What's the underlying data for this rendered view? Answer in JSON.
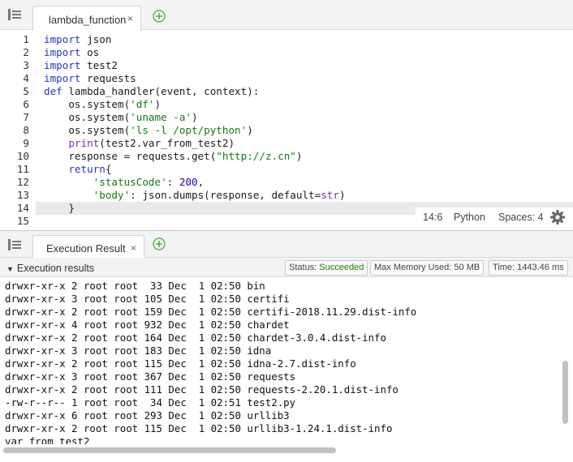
{
  "editor": {
    "tab_label": "lambda_function",
    "close_glyph": "×",
    "lines": [
      [
        {
          "t": "import",
          "c": "kw"
        },
        {
          "t": " json",
          "c": ""
        }
      ],
      [
        {
          "t": "import",
          "c": "kw"
        },
        {
          "t": " os",
          "c": ""
        }
      ],
      [
        {
          "t": "import",
          "c": "kw"
        },
        {
          "t": " test2",
          "c": ""
        }
      ],
      [
        {
          "t": "import",
          "c": "kw"
        },
        {
          "t": " requests",
          "c": ""
        }
      ],
      [
        {
          "t": "def",
          "c": "kw"
        },
        {
          "t": " lambda_handler(event, context):",
          "c": ""
        }
      ],
      [
        {
          "t": "    os.system(",
          "c": ""
        },
        {
          "t": "'df'",
          "c": "str"
        },
        {
          "t": ")",
          "c": ""
        }
      ],
      [
        {
          "t": "    os.system(",
          "c": ""
        },
        {
          "t": "'uname -a'",
          "c": "str"
        },
        {
          "t": ")",
          "c": ""
        }
      ],
      [
        {
          "t": "    os.system(",
          "c": ""
        },
        {
          "t": "'ls -l /opt/python'",
          "c": "str"
        },
        {
          "t": ")",
          "c": ""
        }
      ],
      [
        {
          "t": "    ",
          "c": ""
        },
        {
          "t": "print",
          "c": "bi"
        },
        {
          "t": "(test2.var_from_test2)",
          "c": ""
        }
      ],
      [
        {
          "t": "    response = requests.get(",
          "c": ""
        },
        {
          "t": "\"http://z.cn\"",
          "c": "str"
        },
        {
          "t": ")",
          "c": ""
        }
      ],
      [
        {
          "t": "    ",
          "c": ""
        },
        {
          "t": "return",
          "c": "kw"
        },
        {
          "t": "{",
          "c": ""
        }
      ],
      [
        {
          "t": "        ",
          "c": ""
        },
        {
          "t": "'statusCode'",
          "c": "str"
        },
        {
          "t": ": ",
          "c": ""
        },
        {
          "t": "200",
          "c": "num"
        },
        {
          "t": ",",
          "c": ""
        }
      ],
      [
        {
          "t": "        ",
          "c": ""
        },
        {
          "t": "'body'",
          "c": "str"
        },
        {
          "t": ": json.dumps(response, default=",
          "c": ""
        },
        {
          "t": "str",
          "c": "bi"
        },
        {
          "t": ")",
          "c": ""
        }
      ],
      [
        {
          "t": "    }",
          "c": ""
        }
      ],
      [
        {
          "t": "",
          "c": ""
        }
      ]
    ],
    "cursor_position": "14:6",
    "language": "Python",
    "spaces": "Spaces: 4",
    "settings_icon": "gear-icon"
  },
  "result": {
    "tab_label": "Execution Result",
    "close_glyph": "×",
    "section_label": "Execution results",
    "toggle_glyph": "▼",
    "status_label": "Status: ",
    "status_value": "Succeeded",
    "status_color": "#1d8102",
    "memory": "Max Memory Used: 50 MB",
    "time": "Time: 1443.46 ms",
    "output_lines": [
      "drwxr-xr-x 2 root root  33 Dec  1 02:50 bin",
      "drwxr-xr-x 3 root root 105 Dec  1 02:50 certifi",
      "drwxr-xr-x 2 root root 159 Dec  1 02:50 certifi-2018.11.29.dist-info",
      "drwxr-xr-x 4 root root 932 Dec  1 02:50 chardet",
      "drwxr-xr-x 2 root root 164 Dec  1 02:50 chardet-3.0.4.dist-info",
      "drwxr-xr-x 3 root root 183 Dec  1 02:50 idna",
      "drwxr-xr-x 2 root root 115 Dec  1 02:50 idna-2.7.dist-info",
      "drwxr-xr-x 3 root root 367 Dec  1 02:50 requests",
      "drwxr-xr-x 2 root root 111 Dec  1 02:50 requests-2.20.1.dist-info",
      "-rw-r--r-- 1 root root  34 Dec  1 02:51 test2.py",
      "drwxr-xr-x 6 root root 293 Dec  1 02:50 urllib3",
      "drwxr-xr-x 2 root root 115 Dec  1 02:50 urllib3-1.24.1.dist-info",
      "var_from_test2"
    ]
  },
  "colors": {
    "keyword": "#2136c2",
    "string": "#127a12",
    "number": "#1a00b4",
    "builtin": "#7b2bb8",
    "add_button": "#3fae29"
  }
}
